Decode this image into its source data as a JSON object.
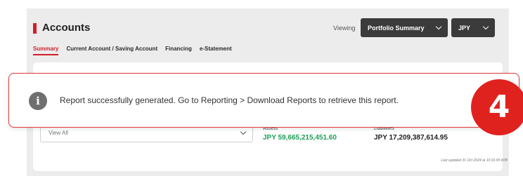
{
  "header": {
    "title": "Accounts",
    "viewing_label": "Viewing",
    "portfolio_select": "Portfolio Summary",
    "currency_select": "JPY"
  },
  "tabs": [
    {
      "label": "Summary",
      "active": true
    },
    {
      "label": "Current Account / Saving Account",
      "active": false
    },
    {
      "label": "Financing",
      "active": false
    },
    {
      "label": "e-Statement",
      "active": false
    }
  ],
  "filter": {
    "value": "View All"
  },
  "summary": {
    "assets_label": "Assets",
    "assets_value": "JPY 59,665,215,451.60",
    "liabilities_label": "Liabilities",
    "liabilities_value": "JPY 17,209,387,614.95",
    "last_updated": "Last updated 31 Oct 2024 at 10:16:09 WIB"
  },
  "toast": {
    "message": "Report successfully generated. Go to Reporting > Download Reports to retrieve this report."
  },
  "step_badge": "4",
  "colors": {
    "accent": "#d21f2b",
    "assets_green": "#1e9e57",
    "dropdown_dark": "#3b3b3b",
    "badge_red": "#e0221f"
  }
}
